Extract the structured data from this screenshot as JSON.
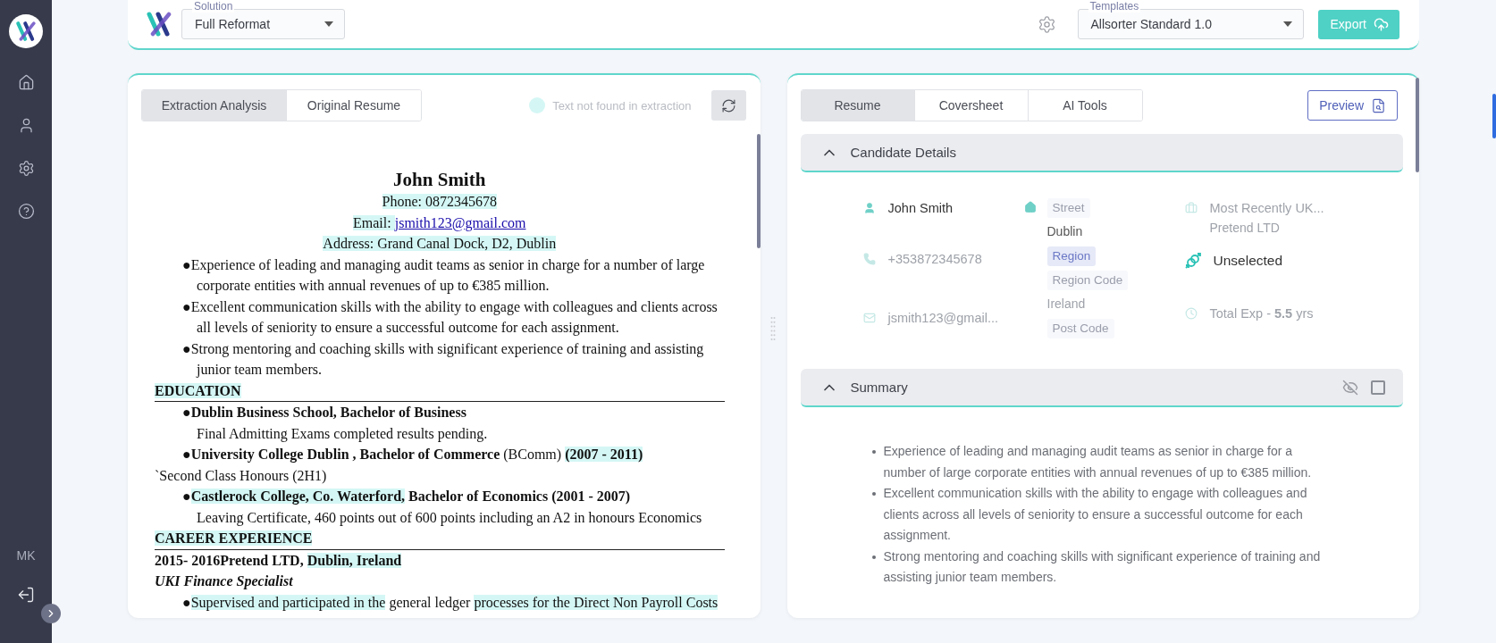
{
  "sidebar": {
    "items": [
      {
        "kind": "home",
        "selected": false
      },
      {
        "kind": "profile",
        "selected": false
      },
      {
        "kind": "settings",
        "selected": false
      },
      {
        "kind": "help",
        "selected": false
      }
    ],
    "user_initials": "MK"
  },
  "toolbar": {
    "solution": {
      "label": "Solution",
      "value": "Full Reformat"
    },
    "templates": {
      "label": "Templates",
      "value": "Allsorter Standard 1.0"
    },
    "export_button": "Export"
  },
  "left_panel": {
    "tabs": [
      {
        "label": "Extraction Analysis",
        "selected": true
      },
      {
        "label": "Original Resume",
        "selected": false
      }
    ],
    "legend": "Text not found in extraction",
    "resume": [
      {
        "kind": "name",
        "segments": [
          {
            "text": "John Smith",
            "highlighted": false
          }
        ]
      },
      {
        "kind": "center",
        "segments": [
          {
            "text": "Phone: 0872345678",
            "highlighted": true
          }
        ]
      },
      {
        "kind": "center",
        "segments": [
          {
            "text": "Email: ",
            "highlighted": true
          },
          {
            "text": "jsmith123@gmail.com",
            "highlighted": false,
            "link": true
          }
        ]
      },
      {
        "kind": "center",
        "segments": [
          {
            "text": "Address: Grand Canal Dock, D2, Dublin",
            "highlighted": true
          }
        ]
      },
      {
        "kind": "bullet",
        "segments": [
          {
            "text": "●Experience of leading and managing audit teams as senior in charge for a number of large corporate entities with annual revenues of up to €385 million.",
            "highlighted": false
          }
        ]
      },
      {
        "kind": "bullet",
        "segments": [
          {
            "text": "●Excellent communication skills with the ability to engage with colleagues and clients across all levels of seniority to ensure a successful outcome for each assignment.",
            "highlighted": false
          }
        ]
      },
      {
        "kind": "bullet",
        "segments": [
          {
            "text": "●Strong mentoring and coaching skills with significant experience of training and assisting junior team members.",
            "highlighted": false
          }
        ]
      },
      {
        "kind": "heading",
        "segments": [
          {
            "text": "EDUCATION",
            "highlighted": true
          }
        ]
      },
      {
        "kind": "bullet",
        "segments": [
          {
            "text": "●Dublin Business School, Bachelor of Business",
            "highlighted": false,
            "bold": true
          }
        ]
      },
      {
        "kind": "detail",
        "segments": [
          {
            "text": "Final Admitting Exams completed results pending.",
            "highlighted": false
          }
        ]
      },
      {
        "kind": "bullet",
        "segments": [
          {
            "text": "●University College Dublin , Bachelor of Commerce ",
            "highlighted": false,
            "bold": true
          },
          {
            "text": "(BComm) ",
            "highlighted": false
          },
          {
            "text": "(2007 - 2011)",
            "highlighted": true,
            "bold": true
          }
        ]
      },
      {
        "kind": "plain",
        "segments": [
          {
            "text": "`Second Class Honours (2H1)",
            "highlighted": false
          }
        ]
      },
      {
        "kind": "bullet",
        "segments": [
          {
            "text": "●",
            "highlighted": false
          },
          {
            "text": "Castlerock College, Co. Waterford,",
            "highlighted": true,
            "bold": true
          },
          {
            "text": " Bachelor of Economics (2001 - 2007)",
            "highlighted": false,
            "bold": true
          }
        ]
      },
      {
        "kind": "detail",
        "segments": [
          {
            "text": "Leaving Certificate, 460 points out of 600 points including an A2 in honours Economics",
            "highlighted": false
          }
        ]
      },
      {
        "kind": "heading",
        "segments": [
          {
            "text": "CAREER EXPERIENCE",
            "highlighted": true
          }
        ]
      },
      {
        "kind": "plain",
        "segments": [
          {
            "text": "2015- 2016Pretend LTD, ",
            "highlighted": false,
            "bold": true
          },
          {
            "text": "Dublin, Ireland",
            "highlighted": true,
            "bold": true
          }
        ]
      },
      {
        "kind": "title",
        "segments": [
          {
            "text": "UKI Finance Specialist",
            "highlighted": false
          }
        ]
      },
      {
        "kind": "bullet",
        "segments": [
          {
            "text": "●",
            "highlighted": false
          },
          {
            "text": "Supervised and participated in the",
            "highlighted": true
          },
          {
            "text": " general ledger ",
            "highlighted": false
          },
          {
            "text": "processes for the Direct Non Payroll Costs",
            "highlighted": true
          }
        ]
      }
    ]
  },
  "right_panel": {
    "tabs": [
      {
        "label": "Resume",
        "selected": true
      },
      {
        "label": "Coversheet",
        "selected": false
      },
      {
        "label": "AI Tools",
        "selected": false
      }
    ],
    "preview_button": "Preview",
    "candidate_details": {
      "title": "Candidate Details",
      "expanded": true,
      "contact": [
        {
          "kind": "person",
          "text": "John Smith",
          "muted": false
        },
        {
          "kind": "phone",
          "text": "+353872345678",
          "muted": true
        },
        {
          "kind": "email",
          "text": "jsmith123@gmail...",
          "muted": true
        }
      ],
      "address": [
        {
          "kind": "tag",
          "text": "Street",
          "selected": false
        },
        {
          "kind": "text",
          "text": "Dublin",
          "muted": false
        },
        {
          "kind": "tag",
          "text": "Region",
          "selected": true
        },
        {
          "kind": "tag",
          "text": "Region Code",
          "selected": false
        },
        {
          "kind": "text",
          "text": "Ireland",
          "muted": true
        },
        {
          "kind": "tag",
          "text": "Post Code",
          "selected": false
        }
      ],
      "job": {
        "role": "Most Recently UK...",
        "company": "Pretend LTD",
        "muted": true
      },
      "gender": {
        "text": "Unselected",
        "muted": false
      },
      "experience": {
        "text": "Total Exp - **5.5** yrs",
        "muted": true
      }
    },
    "summary": {
      "title": "Summary",
      "expanded": true,
      "included": false,
      "bullets": [
        "Experience of leading and managing audit teams as senior in charge for a number of large corporate entities with annual revenues of up to €385 million.",
        "Excellent communication skills with the ability to engage with colleagues and clients across all levels of seniority to ensure a successful outcome for each assignment.",
        "Strong mentoring and coaching skills with significant experience of training and assisting junior team members."
      ]
    }
  }
}
